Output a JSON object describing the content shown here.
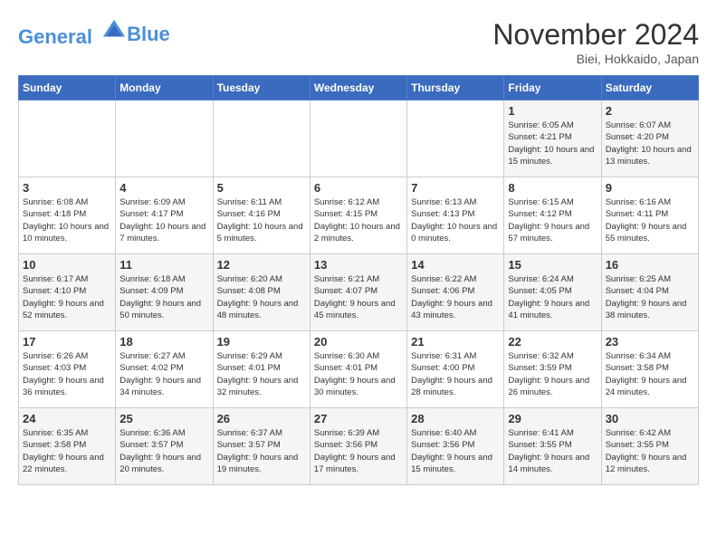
{
  "logo": {
    "line1": "General",
    "line2": "Blue"
  },
  "title": "November 2024",
  "location": "Biei, Hokkaido, Japan",
  "days_of_week": [
    "Sunday",
    "Monday",
    "Tuesday",
    "Wednesday",
    "Thursday",
    "Friday",
    "Saturday"
  ],
  "weeks": [
    [
      {
        "day": "",
        "info": ""
      },
      {
        "day": "",
        "info": ""
      },
      {
        "day": "",
        "info": ""
      },
      {
        "day": "",
        "info": ""
      },
      {
        "day": "",
        "info": ""
      },
      {
        "day": "1",
        "info": "Sunrise: 6:05 AM\nSunset: 4:21 PM\nDaylight: 10 hours and 15 minutes."
      },
      {
        "day": "2",
        "info": "Sunrise: 6:07 AM\nSunset: 4:20 PM\nDaylight: 10 hours and 13 minutes."
      }
    ],
    [
      {
        "day": "3",
        "info": "Sunrise: 6:08 AM\nSunset: 4:18 PM\nDaylight: 10 hours and 10 minutes."
      },
      {
        "day": "4",
        "info": "Sunrise: 6:09 AM\nSunset: 4:17 PM\nDaylight: 10 hours and 7 minutes."
      },
      {
        "day": "5",
        "info": "Sunrise: 6:11 AM\nSunset: 4:16 PM\nDaylight: 10 hours and 5 minutes."
      },
      {
        "day": "6",
        "info": "Sunrise: 6:12 AM\nSunset: 4:15 PM\nDaylight: 10 hours and 2 minutes."
      },
      {
        "day": "7",
        "info": "Sunrise: 6:13 AM\nSunset: 4:13 PM\nDaylight: 10 hours and 0 minutes."
      },
      {
        "day": "8",
        "info": "Sunrise: 6:15 AM\nSunset: 4:12 PM\nDaylight: 9 hours and 57 minutes."
      },
      {
        "day": "9",
        "info": "Sunrise: 6:16 AM\nSunset: 4:11 PM\nDaylight: 9 hours and 55 minutes."
      }
    ],
    [
      {
        "day": "10",
        "info": "Sunrise: 6:17 AM\nSunset: 4:10 PM\nDaylight: 9 hours and 52 minutes."
      },
      {
        "day": "11",
        "info": "Sunrise: 6:18 AM\nSunset: 4:09 PM\nDaylight: 9 hours and 50 minutes."
      },
      {
        "day": "12",
        "info": "Sunrise: 6:20 AM\nSunset: 4:08 PM\nDaylight: 9 hours and 48 minutes."
      },
      {
        "day": "13",
        "info": "Sunrise: 6:21 AM\nSunset: 4:07 PM\nDaylight: 9 hours and 45 minutes."
      },
      {
        "day": "14",
        "info": "Sunrise: 6:22 AM\nSunset: 4:06 PM\nDaylight: 9 hours and 43 minutes."
      },
      {
        "day": "15",
        "info": "Sunrise: 6:24 AM\nSunset: 4:05 PM\nDaylight: 9 hours and 41 minutes."
      },
      {
        "day": "16",
        "info": "Sunrise: 6:25 AM\nSunset: 4:04 PM\nDaylight: 9 hours and 38 minutes."
      }
    ],
    [
      {
        "day": "17",
        "info": "Sunrise: 6:26 AM\nSunset: 4:03 PM\nDaylight: 9 hours and 36 minutes."
      },
      {
        "day": "18",
        "info": "Sunrise: 6:27 AM\nSunset: 4:02 PM\nDaylight: 9 hours and 34 minutes."
      },
      {
        "day": "19",
        "info": "Sunrise: 6:29 AM\nSunset: 4:01 PM\nDaylight: 9 hours and 32 minutes."
      },
      {
        "day": "20",
        "info": "Sunrise: 6:30 AM\nSunset: 4:01 PM\nDaylight: 9 hours and 30 minutes."
      },
      {
        "day": "21",
        "info": "Sunrise: 6:31 AM\nSunset: 4:00 PM\nDaylight: 9 hours and 28 minutes."
      },
      {
        "day": "22",
        "info": "Sunrise: 6:32 AM\nSunset: 3:59 PM\nDaylight: 9 hours and 26 minutes."
      },
      {
        "day": "23",
        "info": "Sunrise: 6:34 AM\nSunset: 3:58 PM\nDaylight: 9 hours and 24 minutes."
      }
    ],
    [
      {
        "day": "24",
        "info": "Sunrise: 6:35 AM\nSunset: 3:58 PM\nDaylight: 9 hours and 22 minutes."
      },
      {
        "day": "25",
        "info": "Sunrise: 6:36 AM\nSunset: 3:57 PM\nDaylight: 9 hours and 20 minutes."
      },
      {
        "day": "26",
        "info": "Sunrise: 6:37 AM\nSunset: 3:57 PM\nDaylight: 9 hours and 19 minutes."
      },
      {
        "day": "27",
        "info": "Sunrise: 6:39 AM\nSunset: 3:56 PM\nDaylight: 9 hours and 17 minutes."
      },
      {
        "day": "28",
        "info": "Sunrise: 6:40 AM\nSunset: 3:56 PM\nDaylight: 9 hours and 15 minutes."
      },
      {
        "day": "29",
        "info": "Sunrise: 6:41 AM\nSunset: 3:55 PM\nDaylight: 9 hours and 14 minutes."
      },
      {
        "day": "30",
        "info": "Sunrise: 6:42 AM\nSunset: 3:55 PM\nDaylight: 9 hours and 12 minutes."
      }
    ]
  ]
}
